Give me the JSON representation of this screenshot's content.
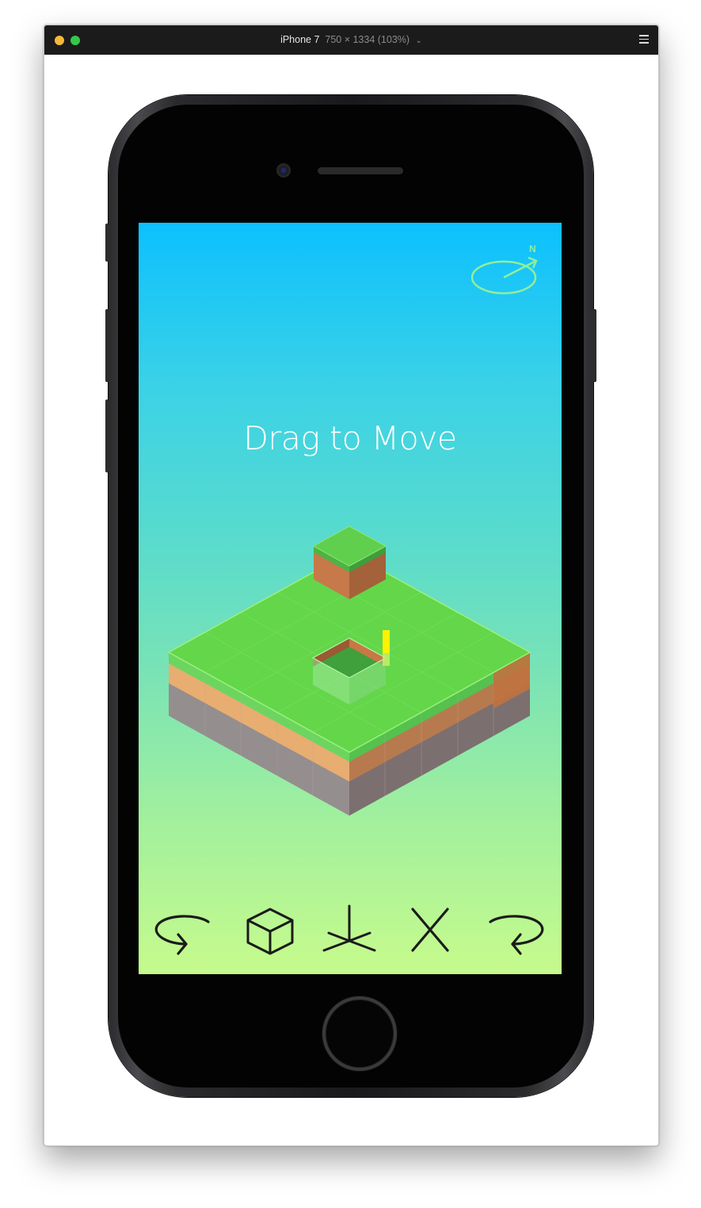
{
  "window": {
    "device_name": "iPhone 7",
    "resolution": "750 × 1334 (103%)"
  },
  "game": {
    "hint_text": "Drag to Move",
    "compass_label": "N",
    "colors": {
      "sky_top": "#0cc0fe",
      "sky_bottom": "#c6fb8c",
      "grass": "#62d548",
      "dirt": "#e6a96e",
      "stone": "#948b8b",
      "highlight": "#fff200"
    }
  },
  "toolbar": {
    "buttons": [
      {
        "name": "rotate-left-button",
        "icon": "rotate-left-icon"
      },
      {
        "name": "add-block-button",
        "icon": "cube-icon"
      },
      {
        "name": "axis-button",
        "icon": "axis-icon"
      },
      {
        "name": "delete-button",
        "icon": "close-icon"
      },
      {
        "name": "rotate-right-button",
        "icon": "rotate-right-icon"
      }
    ]
  }
}
